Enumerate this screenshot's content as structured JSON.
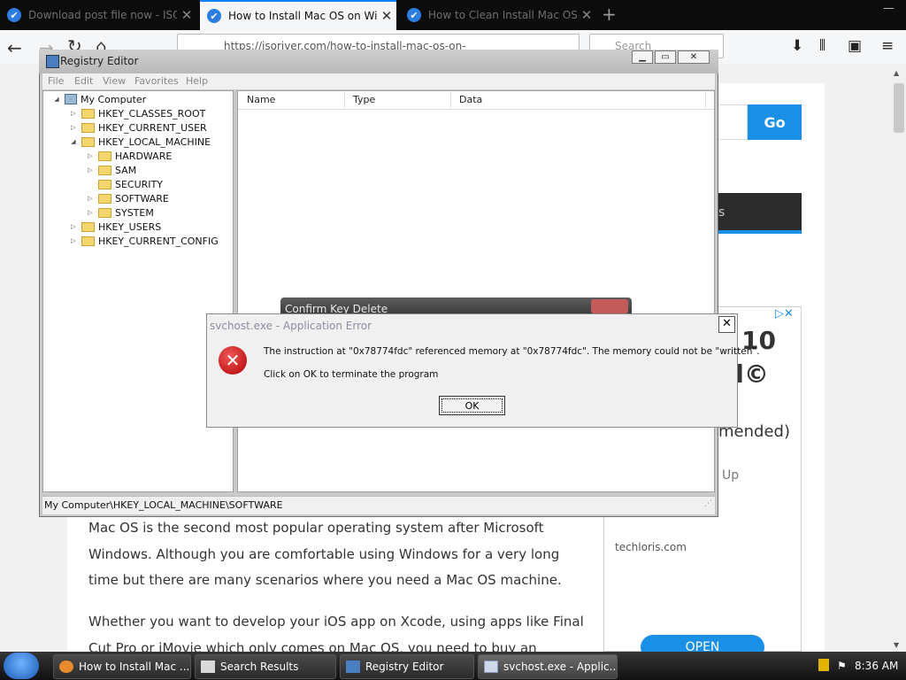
{
  "browser": {
    "tabs": [
      {
        "label": "Download post file now - ISOR",
        "active": false
      },
      {
        "label": "How to Install Mac OS on Wind",
        "active": true
      },
      {
        "label": "How to Clean Install Mac OS u",
        "active": false
      }
    ],
    "url": "https://isoriver.com/how-to-install-mac-os-on-",
    "search_placeholder": "Search"
  },
  "webpage": {
    "go_label": "Go",
    "nav_fragment": "s",
    "ad": {
      "line1": "10",
      "line2": "ol©",
      "line3": "mended)",
      "line4": "Up",
      "domain": "techloris.com",
      "open_label": "OPEN"
    },
    "paragraphs": [
      "Mac OS is the second most popular operating system after Microsoft Windows. Although you are comfortable using Windows for a very long time but there are many scenarios where you need a Mac OS machine.",
      "Whether you want to develop your iOS app on Xcode, using apps like Final Cut Pro or iMovie which only comes on Mac OS, you need to buy an expensive Apple"
    ]
  },
  "regedit": {
    "title": "Registry Editor",
    "menu": [
      "File",
      "Edit",
      "View",
      "Favorites",
      "Help"
    ],
    "tree": [
      {
        "label": "My Computer",
        "level": 0,
        "expander": "◢",
        "kind": "computer"
      },
      {
        "label": "HKEY_CLASSES_ROOT",
        "level": 1,
        "expander": "▷",
        "kind": "folder"
      },
      {
        "label": "HKEY_CURRENT_USER",
        "level": 1,
        "expander": "▷",
        "kind": "folder"
      },
      {
        "label": "HKEY_LOCAL_MACHINE",
        "level": 1,
        "expander": "◢",
        "kind": "folder"
      },
      {
        "label": "HARDWARE",
        "level": 2,
        "expander": "▷",
        "kind": "folder"
      },
      {
        "label": "SAM",
        "level": 2,
        "expander": "▷",
        "kind": "folder"
      },
      {
        "label": "SECURITY",
        "level": 2,
        "expander": "",
        "kind": "folder"
      },
      {
        "label": "SOFTWARE",
        "level": 2,
        "expander": "▷",
        "kind": "folder"
      },
      {
        "label": "SYSTEM",
        "level": 2,
        "expander": "▷",
        "kind": "folder"
      },
      {
        "label": "HKEY_USERS",
        "level": 1,
        "expander": "▷",
        "kind": "folder"
      },
      {
        "label": "HKEY_CURRENT_CONFIG",
        "level": 1,
        "expander": "▷",
        "kind": "folder"
      }
    ],
    "columns": [
      "Name",
      "Type",
      "Data"
    ],
    "status": "My Computer\\HKEY_LOCAL_MACHINE\\SOFTWARE"
  },
  "confirm_dialog": {
    "title": "Confirm Key Delete"
  },
  "error_dialog": {
    "title": "svchost.exe - Application Error",
    "message": "The instruction at \"0x78774fdc\" referenced memory at \"0x78774fdc\". The memory could not be \"written\".",
    "instruction": "Click on OK to terminate the program",
    "ok_label": "OK"
  },
  "taskbar": {
    "items": [
      {
        "label": "How to Install Mac ...",
        "active": false
      },
      {
        "label": "Search Results",
        "active": false
      },
      {
        "label": "Registry Editor",
        "active": false
      },
      {
        "label": "svchost.exe - Applic...",
        "active": true
      }
    ],
    "clock": "8:36 AM"
  },
  "colors": {
    "accent": "#1a8fe6",
    "error_red": "#c00000",
    "taskbar": "#1f1f1f"
  }
}
